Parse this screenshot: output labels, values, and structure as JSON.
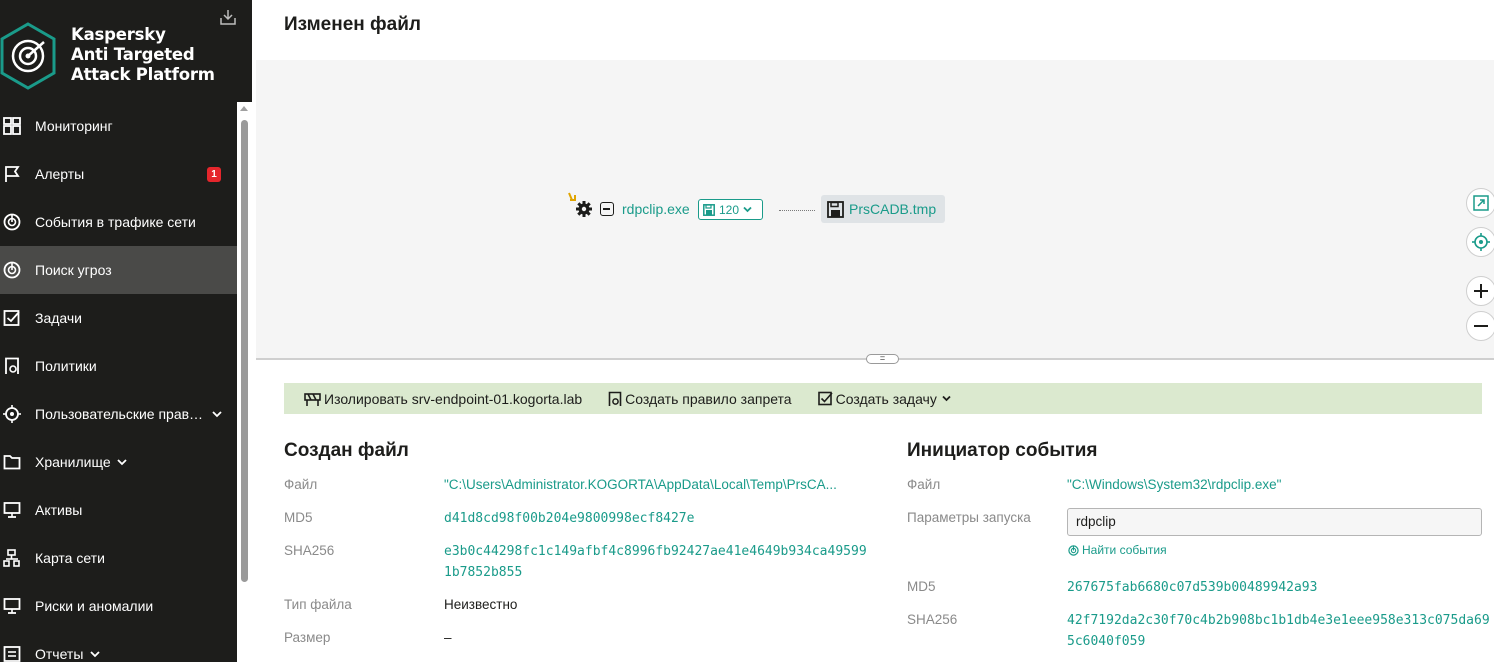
{
  "app": {
    "brand_line1": "Kaspersky",
    "brand_line2": "Anti Targeted",
    "brand_line3": "Attack Platform",
    "accent_color": "#1a9b8a",
    "sidebar_bg": "#1d1d1b"
  },
  "sidebar": {
    "items": [
      {
        "label": "Мониторинг",
        "icon": "dashboard-icon"
      },
      {
        "label": "Алерты",
        "icon": "flag-icon",
        "badge": "1"
      },
      {
        "label": "События в трафике сети",
        "icon": "network-traffic-icon"
      },
      {
        "label": "Поиск угроз",
        "icon": "threat-hunting-icon",
        "active": true
      },
      {
        "label": "Задачи",
        "icon": "tasks-checkbox-icon"
      },
      {
        "label": "Политики",
        "icon": "policy-icon"
      },
      {
        "label": "Пользовательские прав…",
        "icon": "target-icon",
        "expandable": true
      },
      {
        "label": "Хранилище",
        "icon": "folder-icon",
        "expandable": true
      },
      {
        "label": "Активы",
        "icon": "monitor-icon"
      },
      {
        "label": "Карта сети",
        "icon": "network-map-icon"
      },
      {
        "label": "Риски и аномалии",
        "icon": "monitor-icon"
      },
      {
        "label": "Отчеты",
        "icon": "reports-icon",
        "expandable": true
      }
    ]
  },
  "page": {
    "title": "Изменен файл"
  },
  "graph": {
    "process_name": "rdpclip.exe",
    "process_count": "120",
    "file_name": "PrsCADB.tmp",
    "handle_glyph": "="
  },
  "actions": {
    "isolate": "Изолировать srv-endpoint-01.kogorta.lab",
    "create_rule": "Создать правило запрета",
    "create_task": "Создать задачу"
  },
  "created_file": {
    "title": "Создан файл",
    "file_label": "Файл",
    "file_value": "\"C:\\Users\\Administrator.KOGORTA\\AppData\\Local\\Temp\\PrsCA...",
    "md5_label": "MD5",
    "md5_value": "d41d8cd98f00b204e9800998ecf8427e",
    "sha256_label": "SHA256",
    "sha256_value": "e3b0c44298fc1c149afbf4c8996fb92427ae41e4649b934ca495991b7852b855",
    "type_label": "Тип файла",
    "type_value": "Неизвестно",
    "size_label": "Размер",
    "size_value": "–"
  },
  "initiator": {
    "title": "Инициатор события",
    "file_label": "Файл",
    "file_value": "\"C:\\Windows\\System32\\rdpclip.exe\"",
    "params_label": "Параметры запуска",
    "params_value": "rdpclip",
    "find_events": "Найти события",
    "md5_label": "MD5",
    "md5_value": "267675fab6680c07d539b00489942a93",
    "sha256_label": "SHA256",
    "sha256_value": "42f7192da2c30f70c4b2b908bc1b1db4e3e1eee958e313c075da695c6040f059"
  }
}
